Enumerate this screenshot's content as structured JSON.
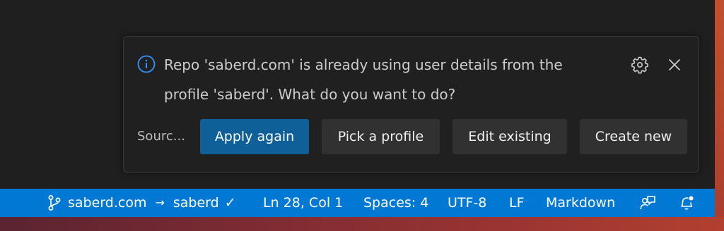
{
  "colors": {
    "status_bar": "#0078d4",
    "editor_bg": "#1f1f1f",
    "notification_bg": "#202020",
    "primary_button": "#0f5f99",
    "secondary_button": "#313131"
  },
  "notification": {
    "icon": "info-icon",
    "message_line1": "Repo 'saberd.com' is already using user details from the",
    "message_line2": "profile 'saberd'. What do you want to do?",
    "source": "Sourc...",
    "settings_icon": "gear-icon",
    "close_icon": "close-icon",
    "buttons": [
      {
        "label": "Apply again",
        "primary": true
      },
      {
        "label": "Pick a profile",
        "primary": false
      },
      {
        "label": "Edit existing",
        "primary": false
      },
      {
        "label": "Create new",
        "primary": false
      }
    ]
  },
  "status_bar": {
    "branch_icon": "source-control-icon",
    "repo": "saberd.com",
    "arrow": "→",
    "profile": "saberd",
    "check": "✓",
    "position": "Ln 28, Col 1",
    "indentation": "Spaces: 4",
    "encoding": "UTF-8",
    "eol": "LF",
    "language": "Markdown",
    "feedback_icon": "feedback-icon",
    "notifications_icon": "bell-dot-icon"
  }
}
